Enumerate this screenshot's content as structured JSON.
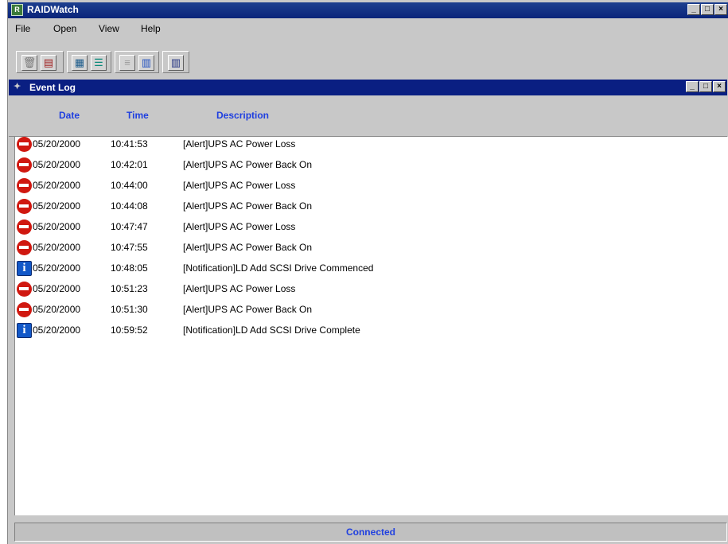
{
  "app": {
    "title": "RAIDWatch"
  },
  "menu": {
    "items": [
      "File",
      "Open",
      "View",
      "Help"
    ]
  },
  "toolbar": {
    "icons": [
      "trash-icon",
      "document-icon",
      "grid-icon",
      "disk-stack-icon",
      "list-icon",
      "bar-chart-icon",
      "columns-icon"
    ]
  },
  "event_log": {
    "title": "Event Log",
    "columns": {
      "date": "Date",
      "time": "Time",
      "description": "Description"
    },
    "rows": [
      {
        "type": "alert",
        "date": "05/20/2000",
        "time": "10:41:53",
        "description": "[Alert]UPS AC Power Loss"
      },
      {
        "type": "alert",
        "date": "05/20/2000",
        "time": "10:42:01",
        "description": "[Alert]UPS AC Power Back On"
      },
      {
        "type": "alert",
        "date": "05/20/2000",
        "time": "10:44:00",
        "description": "[Alert]UPS AC Power Loss"
      },
      {
        "type": "alert",
        "date": "05/20/2000",
        "time": "10:44:08",
        "description": "[Alert]UPS AC Power Back On"
      },
      {
        "type": "alert",
        "date": "05/20/2000",
        "time": "10:47:47",
        "description": "[Alert]UPS AC Power Loss"
      },
      {
        "type": "alert",
        "date": "05/20/2000",
        "time": "10:47:55",
        "description": "[Alert]UPS AC Power Back On"
      },
      {
        "type": "info",
        "date": "05/20/2000",
        "time": "10:48:05",
        "description": "[Notification]LD Add SCSI Drive Commenced"
      },
      {
        "type": "alert",
        "date": "05/20/2000",
        "time": "10:51:23",
        "description": "[Alert]UPS AC Power Loss"
      },
      {
        "type": "alert",
        "date": "05/20/2000",
        "time": "10:51:30",
        "description": "[Alert]UPS AC Power Back On"
      },
      {
        "type": "info",
        "date": "05/20/2000",
        "time": "10:59:52",
        "description": "[Notification]LD Add SCSI Drive Complete"
      }
    ]
  },
  "status": {
    "text": "Connected"
  },
  "colors": {
    "titlebar": "#0a247a",
    "header_text": "#2040e0",
    "alert": "#d01810",
    "info": "#1258c8"
  }
}
